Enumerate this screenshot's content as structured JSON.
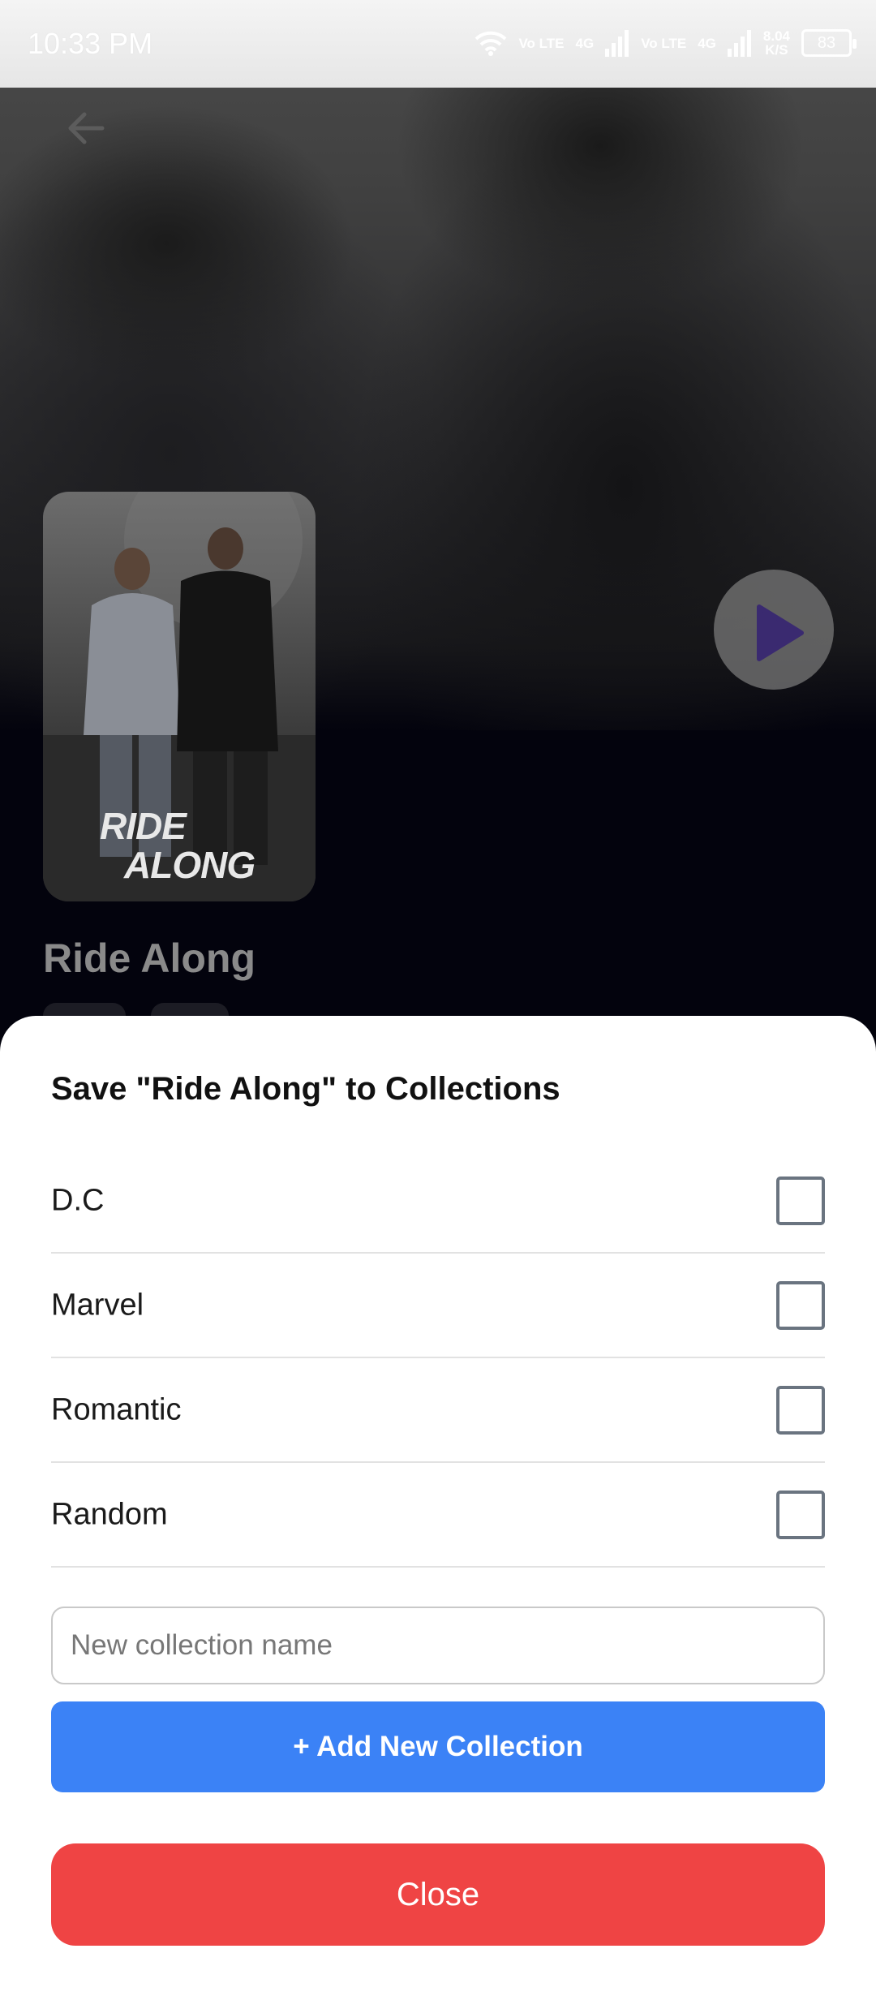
{
  "status_bar": {
    "time": "10:33 PM",
    "net_speed_value": "8.04",
    "net_speed_unit": "K/S",
    "battery": "83",
    "sim1_label": "Vo LTE",
    "sim1_net": "4G",
    "sim2_label": "Vo LTE",
    "sim2_net": "4G"
  },
  "movie": {
    "title": "Ride Along",
    "poster_line1": "RIDE",
    "poster_line2": "ALONG"
  },
  "sheet": {
    "title": "Save \"Ride Along\" to Collections",
    "collections": [
      {
        "label": "D.C",
        "checked": false
      },
      {
        "label": "Marvel",
        "checked": false
      },
      {
        "label": "Romantic",
        "checked": false
      },
      {
        "label": "Random",
        "checked": false
      }
    ],
    "new_collection": {
      "placeholder": "New collection name",
      "value": ""
    },
    "add_button_label": "+ Add New Collection",
    "close_button_label": "Close"
  },
  "colors": {
    "add_button": "#3b82f6",
    "close_button": "#ef4444",
    "checkbox_border": "#6a7480"
  }
}
